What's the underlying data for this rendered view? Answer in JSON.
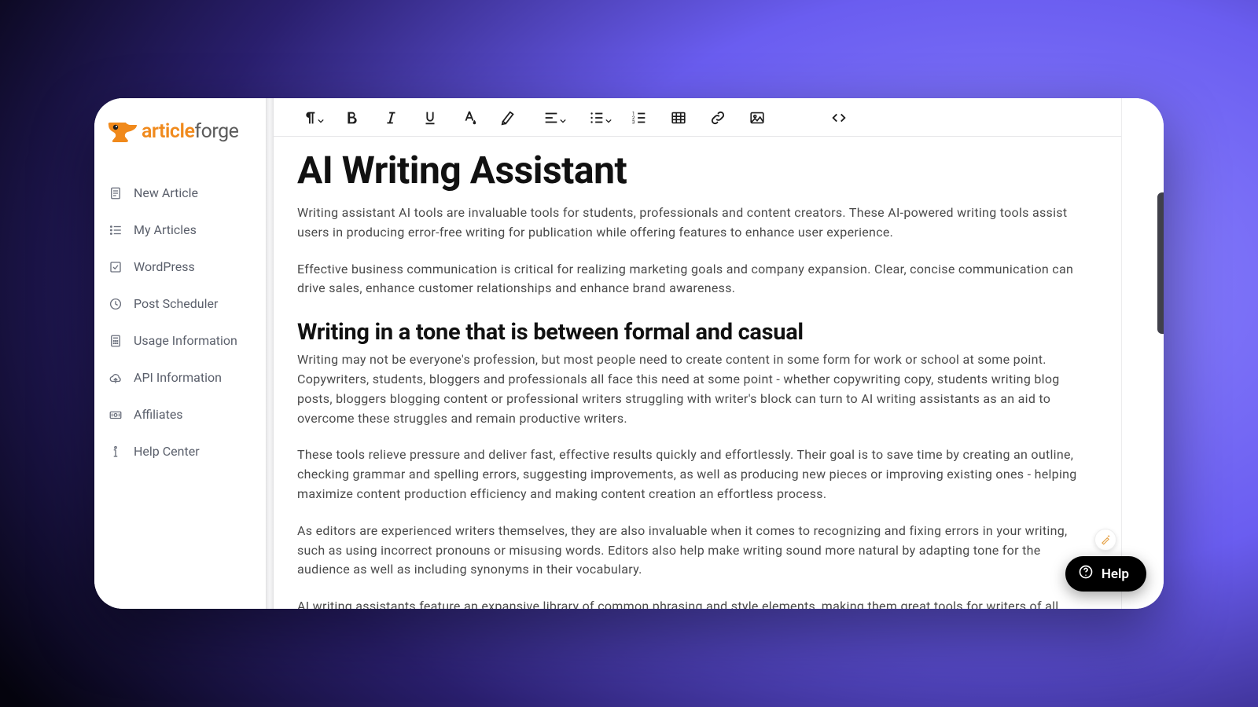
{
  "brand": {
    "word1": "article",
    "word2": "forge"
  },
  "sidebar": {
    "items": [
      {
        "label": "New Article"
      },
      {
        "label": "My Articles"
      },
      {
        "label": "WordPress"
      },
      {
        "label": "Post Scheduler"
      },
      {
        "label": "Usage Information"
      },
      {
        "label": "API Information"
      },
      {
        "label": "Affiliates"
      },
      {
        "label": "Help Center"
      }
    ]
  },
  "article": {
    "title": "AI Writing Assistant",
    "p1": "Writing assistant AI tools are invaluable tools for students, professionals and content creators. These AI-powered writing tools assist users in producing error-free writing for publication while offering features to enhance user experience.",
    "p2": "Effective business communication is critical for realizing marketing goals and company expansion. Clear, concise communication can drive sales, enhance customer relationships and enhance brand awareness.",
    "h2": "Writing in a tone that is between formal and casual",
    "p3": "Writing may not be everyone's profession, but most people need to create content in some form for work or school at some point. Copywriters, students, bloggers and professionals all face this need at some point - whether copywriting copy, students writing blog posts, bloggers blogging content or professional writers struggling with writer's block can turn to AI writing assistants as an aid to overcome these struggles and remain productive writers.",
    "p4": "These tools relieve pressure and deliver fast, effective results quickly and effortlessly. Their goal is to save time by creating an outline, checking grammar and spelling errors, suggesting improvements, as well as producing new pieces or improving existing ones - helping maximize content production efficiency and making content creation an effortless process.",
    "p5": "As editors are experienced writers themselves, they are also invaluable when it comes to recognizing and fixing errors in your writing, such as using incorrect pronouns or misusing words. Editors also help make writing sound more natural by adapting tone for the audience as well as including synonyms in their vocabulary.",
    "p6": "AI writing assistants feature an expansive library of common phrasing and style elements, making them great tools for writers of all levels of experience; for instance, if your language tends towards informality, the AI will automatically adjust it towards formality."
  },
  "help": {
    "label": "Help"
  }
}
